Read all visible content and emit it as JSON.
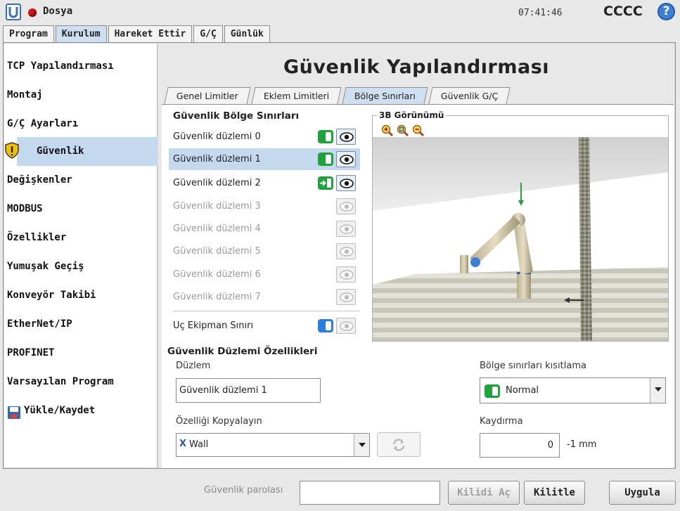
{
  "header": {
    "menu_title": "Dosya",
    "clock": "07:41:46",
    "robot_name": "CCCC",
    "help_symbol": "?"
  },
  "main_tabs": [
    {
      "label": "Program",
      "active": false
    },
    {
      "label": "Kurulum",
      "active": true
    },
    {
      "label": "Hareket Ettir",
      "active": false
    },
    {
      "label": "G/Ç",
      "active": false
    },
    {
      "label": "Günlük",
      "active": false
    }
  ],
  "sidebar": {
    "items": [
      {
        "label": "TCP Yapılandırması"
      },
      {
        "label": "Montaj"
      },
      {
        "label": "G/Ç Ayarları"
      },
      {
        "label": "Güvenlik",
        "active": true
      },
      {
        "label": "Değişkenler"
      },
      {
        "label": "MODBUS"
      },
      {
        "label": "Özellikler"
      },
      {
        "label": "Yumuşak Geçiş"
      },
      {
        "label": "Konveyör Takibi"
      },
      {
        "label": "EtherNet/IP"
      },
      {
        "label": "PROFINET"
      },
      {
        "label": "Varsayılan Program"
      },
      {
        "label": "Yükle/Kaydet"
      }
    ]
  },
  "page_title": "Güvenlik Yapılandırması",
  "sub_tabs": [
    {
      "label": "Genel Limitler",
      "active": false
    },
    {
      "label": "Eklem Limitleri",
      "active": false
    },
    {
      "label": "Bölge Sınırları",
      "active": true
    },
    {
      "label": "Güvenlik G/Ç",
      "active": false
    }
  ],
  "boundaries": {
    "section_label": "Güvenlik Bölge Sınırları",
    "planes": [
      {
        "label": "Güvenlik düzlemi 0",
        "state": "normal",
        "enabled": true
      },
      {
        "label": "Güvenlik düzlemi 1",
        "state": "normal",
        "enabled": true,
        "selected": true
      },
      {
        "label": "Güvenlik düzlemi 2",
        "state": "trigger",
        "enabled": true
      },
      {
        "label": "Güvenlik düzlemi 3",
        "state": "off",
        "enabled": false
      },
      {
        "label": "Güvenlik düzlemi 4",
        "state": "off",
        "enabled": false
      },
      {
        "label": "Güvenlik düzlemi 5",
        "state": "off",
        "enabled": false
      },
      {
        "label": "Güvenlik düzlemi 6",
        "state": "off",
        "enabled": false
      },
      {
        "label": "Güvenlik düzlemi 7",
        "state": "off",
        "enabled": false
      }
    ],
    "tool_boundary": {
      "label": "Uç Ekipman Sınırı",
      "state": "blue"
    }
  },
  "view3d": {
    "label": "3B Görünümü"
  },
  "properties": {
    "section_label": "Güvenlik Düzlemi Özellikleri",
    "plane_label": "Düzlem",
    "plane_value": "Güvenlik düzlemi 1",
    "restriction_label": "Bölge sınırları kısıtlama",
    "restriction_value": "Normal",
    "copy_label": "Özelliği Kopyalayın",
    "copy_value": "Wall",
    "copy_icon": "X",
    "offset_label": "Kaydırma",
    "offset_value": "0",
    "offset_unit": "-1 mm"
  },
  "footer": {
    "password_label": "Güvenlik parolası",
    "unlock_label": "Kilidi Aç",
    "lock_label": "Kilitle",
    "apply_label": "Uygula"
  },
  "colors": {
    "accent_blue": "#c4d8ee",
    "toggle_green": "#1ea33c",
    "toggle_blue": "#2b7de0",
    "status_red": "#d4161c"
  }
}
